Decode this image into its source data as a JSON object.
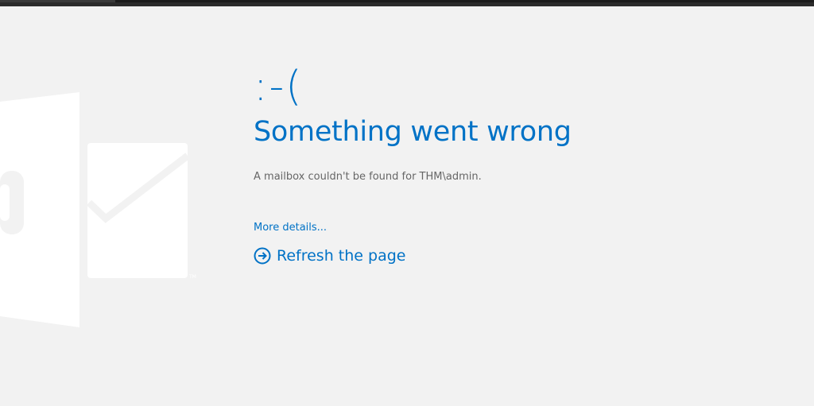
{
  "error": {
    "emoticon": ":-(",
    "title": "Something went wrong",
    "message": "A mailbox couldn't be found for THM\\admin.",
    "details_link": "More details...",
    "refresh_label": "Refresh the page"
  },
  "icons": {
    "logo": "outlook-logo-icon",
    "refresh": "arrow-circle-right-icon"
  },
  "colors": {
    "accent": "#0072c6",
    "background": "#f2f2f2",
    "message_text": "#666666",
    "logo_fill": "#ffffff"
  }
}
